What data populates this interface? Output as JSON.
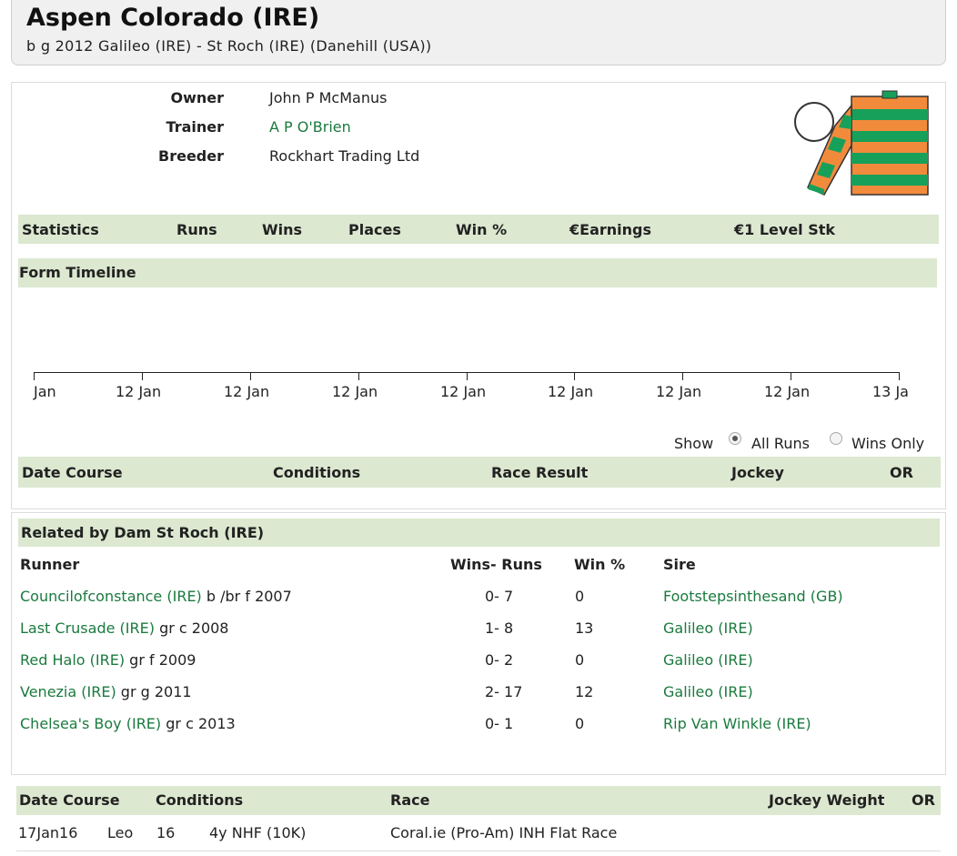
{
  "horse": {
    "name": "Aspen Colorado (IRE)",
    "pedigree": "b g 2012 Galileo (IRE) - St Roch (IRE) (Danehill (USA))"
  },
  "connections": {
    "owner_label": "Owner",
    "owner": "John P McManus",
    "trainer_label": "Trainer",
    "trainer": "A P O'Brien",
    "breeder_label": "Breeder",
    "breeder": "Rockhart Trading Ltd"
  },
  "silks": {
    "primary_color": "#f28a3c",
    "secondary_color": "#17a05a",
    "cap_color": "#ffffff",
    "icon": "jockey-silks-icon"
  },
  "statistics": {
    "headers": [
      "Statistics",
      "Runs",
      "Wins",
      "Places",
      "Win %",
      "€Earnings",
      "€1 Level Stk"
    ]
  },
  "form_timeline": {
    "title": "Form Timeline",
    "labels": [
      "Jan",
      "12 Jan",
      "12 Jan",
      "12 Jan",
      "12 Jan",
      "12 Jan",
      "12 Jan",
      "12 Jan",
      "13 Ja"
    ]
  },
  "filter": {
    "show_label": "Show",
    "all_runs": "All Runs",
    "wins_only": "Wins Only",
    "selected": "All Runs"
  },
  "results_table": {
    "headers": [
      "Date Course",
      "Conditions",
      "Race Result",
      "Jockey",
      "OR"
    ]
  },
  "related": {
    "title": "Related by Dam St Roch (IRE)",
    "headers": {
      "runner": "Runner",
      "wins_runs": "Wins- Runs",
      "win_pct": "Win %",
      "sire": "Sire"
    },
    "rows": [
      {
        "name": "Councilofconstance (IRE)",
        "desc": "b /br f 2007",
        "wins_runs": "0- 7",
        "win_pct": "0",
        "sire": "Footstepsinthesand (GB)"
      },
      {
        "name": "Last Crusade (IRE)",
        "desc": "gr c 2008",
        "wins_runs": "1- 8",
        "win_pct": "13",
        "sire": "Galileo (IRE)"
      },
      {
        "name": "Red Halo (IRE)",
        "desc": "gr f 2009",
        "wins_runs": "0- 2",
        "win_pct": "0",
        "sire": "Galileo (IRE)"
      },
      {
        "name": "Venezia (IRE)",
        "desc": "gr g 2011",
        "wins_runs": "2- 17",
        "win_pct": "12",
        "sire": "Galileo (IRE)"
      },
      {
        "name": "Chelsea's Boy (IRE)",
        "desc": "gr c 2013",
        "wins_runs": "0- 1",
        "win_pct": "0",
        "sire": "Rip Van Winkle (IRE)"
      }
    ]
  },
  "entries": {
    "headers": {
      "date_course": "Date Course",
      "conditions": "Conditions",
      "race": "Race",
      "jockey_weight": "Jockey Weight",
      "or": "OR"
    },
    "rows": [
      {
        "date": "17Jan16",
        "course": "Leo",
        "distance": "16",
        "conditions": "4y NHF (10K)",
        "race": "Coral.ie (Pro-Am) INH Flat Race"
      }
    ]
  }
}
